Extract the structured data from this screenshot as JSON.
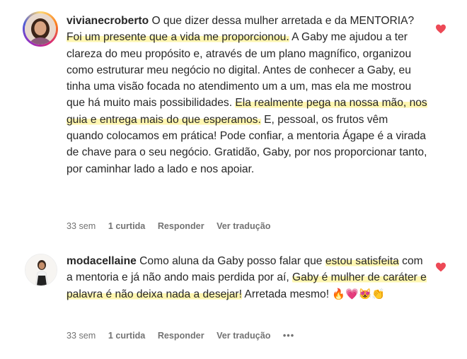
{
  "comments": [
    {
      "username": "vivianecroberto",
      "segments": [
        {
          "t": " O que dizer dessa mulher arretada e da MENTORIA? ",
          "h": false
        },
        {
          "t": "Foi um presente que a vida me proporcionou.",
          "h": true
        },
        {
          "t": " A Gaby me ajudou a ter clareza do meu propósito e, através de um plano magnífico, organizou como estruturar meu negócio no digital. Antes de conhecer a Gaby, eu tinha uma visão focada no atendimento um a um, mas ela me mostrou que há muito mais possibilidades. ",
          "h": false
        },
        {
          "t": "Ela realmente pega na nossa mão, nos guia e entrega mais do que esperamos.",
          "h": true
        },
        {
          "t": " E, pessoal, os frutos vêm quando colocamos em prática! Pode confiar, a mentoria Ágape é a virada de chave para o seu negócio. Gratidão, Gaby, por nos proporcionar tanto, por caminhar lado a lado e nos apoiar.",
          "h": false
        }
      ],
      "time": "33 sem",
      "likes": "1 curtida",
      "reply": "Responder",
      "translate": "Ver tradução"
    },
    {
      "username": "modacellaine",
      "segments": [
        {
          "t": " Como aluna da Gaby posso falar que ",
          "h": false
        },
        {
          "t": "estou satisfeita",
          "h": true
        },
        {
          "t": " com a mentoria e já não ando mais perdida por aí, ",
          "h": false
        },
        {
          "t": "Gaby é mulher de caráter e palavra é não deixa nada a desejar!",
          "h": true
        },
        {
          "t": " Arretada mesmo! ",
          "h": false
        }
      ],
      "emojis": [
        "🔥",
        "💗",
        "😻",
        "👏"
      ],
      "time": "33 sem",
      "likes": "1 curtida",
      "reply": "Responder",
      "translate": "Ver tradução",
      "more": "•••"
    }
  ],
  "colors": {
    "text": "#262626",
    "meta": "#737373",
    "heart": "#ed4956",
    "highlight": "#fff6b0"
  },
  "icons": {
    "like": "heart-icon",
    "options": "more-options-icon"
  }
}
